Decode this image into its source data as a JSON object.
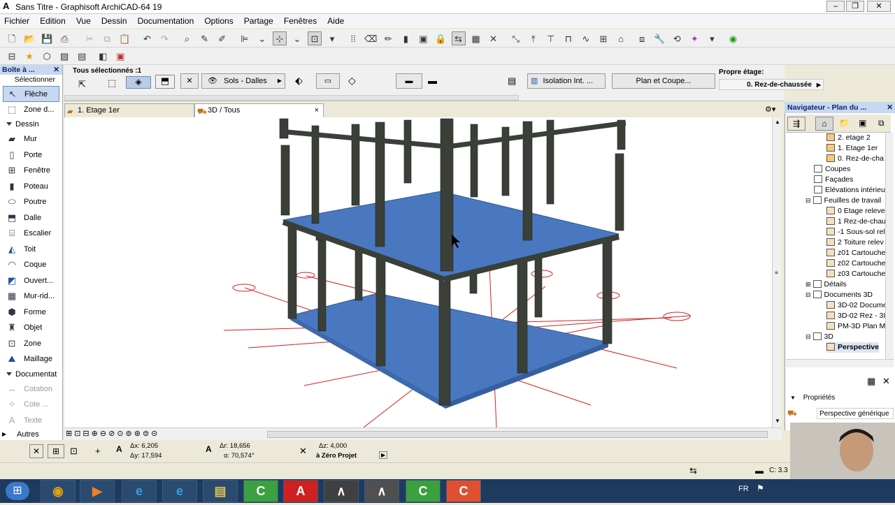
{
  "window": {
    "title": "Sans Titre - Graphisoft ArchiCAD-64 19",
    "logo_glyph": "A"
  },
  "menu": [
    "Fichier",
    "Edition",
    "Vue",
    "Dessin",
    "Documentation",
    "Options",
    "Partage",
    "Fenêtres",
    "Aide"
  ],
  "toolbox": {
    "title": "Boîte à ...",
    "select_label": "Sélectionner",
    "tools_top": [
      {
        "label": "Flèche",
        "icon": "arrow-icon"
      },
      {
        "label": "Zone d...",
        "icon": "marquee-icon"
      }
    ],
    "dessin_header": "Dessin",
    "dessin_tools": [
      {
        "label": "Mur",
        "icon": "wall-icon"
      },
      {
        "label": "Porte",
        "icon": "door-icon"
      },
      {
        "label": "Fenêtre",
        "icon": "window-icon"
      },
      {
        "label": "Poteau",
        "icon": "column-icon"
      },
      {
        "label": "Poutre",
        "icon": "beam-icon"
      },
      {
        "label": "Dalle",
        "icon": "slab-icon"
      },
      {
        "label": "Escalier",
        "icon": "stair-icon"
      },
      {
        "label": "Toit",
        "icon": "roof-icon"
      },
      {
        "label": "Coque",
        "icon": "shell-icon"
      },
      {
        "label": "Ouvert...",
        "icon": "opening-icon"
      },
      {
        "label": "Mur-rid...",
        "icon": "curtain-wall-icon"
      },
      {
        "label": "Forme",
        "icon": "morph-icon"
      },
      {
        "label": "Objet",
        "icon": "object-icon"
      },
      {
        "label": "Zone",
        "icon": "zone-icon"
      },
      {
        "label": "Maillage",
        "icon": "mesh-icon"
      }
    ],
    "documentation_header": "Documentat",
    "doc_tools": [
      {
        "label": "Cotation",
        "icon": "dimension-icon"
      },
      {
        "label": "Cote ...",
        "icon": "level-dimension-icon"
      },
      {
        "label": "Texte",
        "icon": "text-icon"
      }
    ],
    "autres": "Autres"
  },
  "infobox": {
    "selection": "Tous sélectionnés :1",
    "layer": "Sols - Dalles",
    "composite": "Isolation Int. ...",
    "plan_coupe": "Plan et Coupe...",
    "story_label": "Propre étage:",
    "story_value": "0. Rez-de-chaussée"
  },
  "tabs": [
    {
      "label": "1. Etage 1er",
      "icon": "floorplan-icon"
    },
    {
      "label": "3D / Tous",
      "icon": "3d-view-icon",
      "close": "×"
    }
  ],
  "navigator": {
    "title": "Navigateur - Plan du ...",
    "items": [
      {
        "label": "2. etage 2",
        "indent": 2
      },
      {
        "label": "1. Etage 1er",
        "indent": 2
      },
      {
        "label": "0. Rez-de-cha",
        "indent": 2
      },
      {
        "label": "Coupes",
        "indent": 1
      },
      {
        "label": "Façades",
        "indent": 1
      },
      {
        "label": "Elévations intérieu",
        "indent": 1
      },
      {
        "label": "Feuilles de travail",
        "indent": 1
      },
      {
        "label": "0 Etage releve",
        "indent": 2
      },
      {
        "label": "1 Rez-de-chau",
        "indent": 2
      },
      {
        "label": "-1 Sous-sol rel",
        "indent": 2
      },
      {
        "label": "2 Toiture relev",
        "indent": 2
      },
      {
        "label": "z01 Cartouche",
        "indent": 2
      },
      {
        "label": "z02 Cartouche",
        "indent": 2
      },
      {
        "label": "z03 Cartouche",
        "indent": 2
      },
      {
        "label": "Détails",
        "indent": 1
      },
      {
        "label": "Documents 3D",
        "indent": 1
      },
      {
        "label": "3D-02 Docume",
        "indent": 2
      },
      {
        "label": "3D-02 Rez - 3I",
        "indent": 2
      },
      {
        "label": "PM-3D Plan Ma",
        "indent": 2
      },
      {
        "label": "3D",
        "indent": 1
      },
      {
        "label": "Perspective",
        "indent": 2
      }
    ],
    "properties_label": "Propriétés",
    "properties_value": "Perspective générique"
  },
  "coords": {
    "dx": "Δx: 6,205",
    "dy": "Δy: 17,594",
    "dr": "Δr: 18,656",
    "angle": "α: 70,574°",
    "dz": "Δz: 4,000",
    "ref": "à Zéro Projet"
  },
  "status": {
    "disk": "C: 3.3"
  },
  "taskbar": {
    "lang": "FR",
    "apps": [
      {
        "name": "chrome",
        "glyph": "◉"
      },
      {
        "name": "media",
        "glyph": "▶"
      },
      {
        "name": "edge",
        "glyph": "e"
      },
      {
        "name": "ie",
        "glyph": "e"
      },
      {
        "name": "explorer",
        "glyph": "▤"
      },
      {
        "name": "archicad-green",
        "glyph": "C"
      },
      {
        "name": "autocad",
        "glyph": "A"
      },
      {
        "name": "archicad-dark-1",
        "glyph": "∧"
      },
      {
        "name": "archicad-dark-2",
        "glyph": "∧"
      },
      {
        "name": "archicad-green-2",
        "glyph": "C"
      },
      {
        "name": "archicad-red",
        "glyph": "C"
      }
    ]
  },
  "colors": {
    "slab": "#4a78c0",
    "column": "#3a4038",
    "gridline": "#d02020"
  }
}
